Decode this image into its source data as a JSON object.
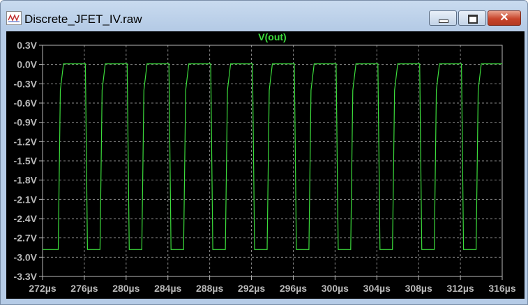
{
  "window": {
    "title": "Discrete_JFET_IV.raw",
    "minimize_icon": "minimize-icon",
    "maximize_icon": "maximize-icon",
    "close_icon": "close-icon",
    "close_glyph": "✕"
  },
  "colors": {
    "background": "#000000",
    "axis": "#b8b8b8",
    "grid": "#8a8a8a",
    "trace": "#3cdc3c",
    "title": "#3cdc3c",
    "tick_text": "#b8b8b8"
  },
  "chart_data": {
    "type": "line",
    "title": "V(out)",
    "xlabel": "",
    "ylabel": "",
    "grid": true,
    "xlim": [
      272,
      316
    ],
    "ylim": [
      -3.3,
      0.3
    ],
    "x_ticks": [
      272,
      276,
      280,
      284,
      288,
      292,
      296,
      300,
      304,
      308,
      312,
      316
    ],
    "x_tick_labels": [
      "272µs",
      "276µs",
      "280µs",
      "284µs",
      "288µs",
      "292µs",
      "296µs",
      "300µs",
      "304µs",
      "308µs",
      "312µs",
      "316µs"
    ],
    "y_ticks": [
      0.3,
      0.0,
      -0.3,
      -0.6,
      -0.9,
      -1.2,
      -1.5,
      -1.8,
      -2.1,
      -2.4,
      -2.7,
      -3.0,
      -3.3
    ],
    "y_tick_labels": [
      "0.3V",
      "0.0V",
      "-0.3V",
      "-0.6V",
      "-0.9V",
      "-1.2V",
      "-1.5V",
      "-1.8V",
      "-2.1V",
      "-2.4V",
      "-2.7V",
      "-3.0V",
      "-3.3V"
    ],
    "series": [
      {
        "x": [
          272.0,
          273.5,
          273.7,
          274.0,
          276.1,
          276.3,
          277.5,
          277.7,
          278.0,
          280.1,
          280.3,
          281.5,
          281.7,
          282.0,
          284.1,
          284.3,
          285.5,
          285.7,
          286.0,
          288.1,
          288.3,
          289.5,
          289.7,
          290.0,
          292.1,
          292.3,
          293.5,
          293.7,
          294.0,
          296.1,
          296.3,
          297.5,
          297.7,
          298.0,
          300.1,
          300.3,
          301.5,
          301.7,
          302.0,
          304.1,
          304.3,
          305.5,
          305.7,
          306.0,
          308.1,
          308.3,
          309.5,
          309.7,
          310.0,
          312.1,
          312.3,
          313.5,
          313.7,
          314.0,
          316.0
        ],
        "y": [
          -2.88,
          -2.88,
          -0.4,
          0.01,
          0.01,
          -2.88,
          -2.88,
          -0.4,
          0.01,
          0.01,
          -2.88,
          -2.88,
          -0.4,
          0.01,
          0.01,
          -2.88,
          -2.88,
          -0.4,
          0.01,
          0.01,
          -2.88,
          -2.88,
          -0.4,
          0.01,
          0.01,
          -2.88,
          -2.88,
          -0.4,
          0.01,
          0.01,
          -2.88,
          -2.88,
          -0.4,
          0.01,
          0.01,
          -2.88,
          -2.88,
          -0.4,
          0.01,
          0.01,
          -2.88,
          -2.88,
          -0.4,
          0.01,
          0.01,
          -2.88,
          -2.88,
          -0.4,
          0.01,
          0.01,
          -2.88,
          -2.88,
          -0.4,
          0.01,
          0.01
        ]
      }
    ]
  }
}
